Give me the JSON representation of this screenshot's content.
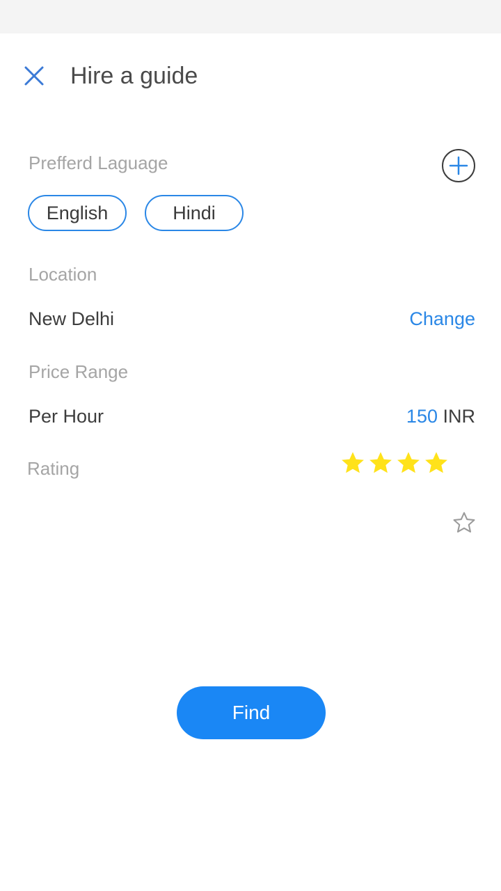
{
  "header": {
    "title": "Hire a guide",
    "close_icon": "close-icon"
  },
  "language": {
    "label": "Prefferd Laguage",
    "add_icon": "plus-circle-icon",
    "chips": [
      "English",
      "Hindi"
    ]
  },
  "location": {
    "label": "Location",
    "value": "New Delhi",
    "change_label": "Change"
  },
  "price": {
    "label": "Price Range",
    "unit": "Per Hour",
    "amount": "150",
    "currency": "INR"
  },
  "rating": {
    "label": "Rating",
    "filled_stars": 4,
    "star_color": "#ffe21a",
    "empty_star_color": "#9b9b9b"
  },
  "actions": {
    "find_label": "Find"
  },
  "colors": {
    "accent": "#2a87e6",
    "button": "#1a87f5"
  }
}
